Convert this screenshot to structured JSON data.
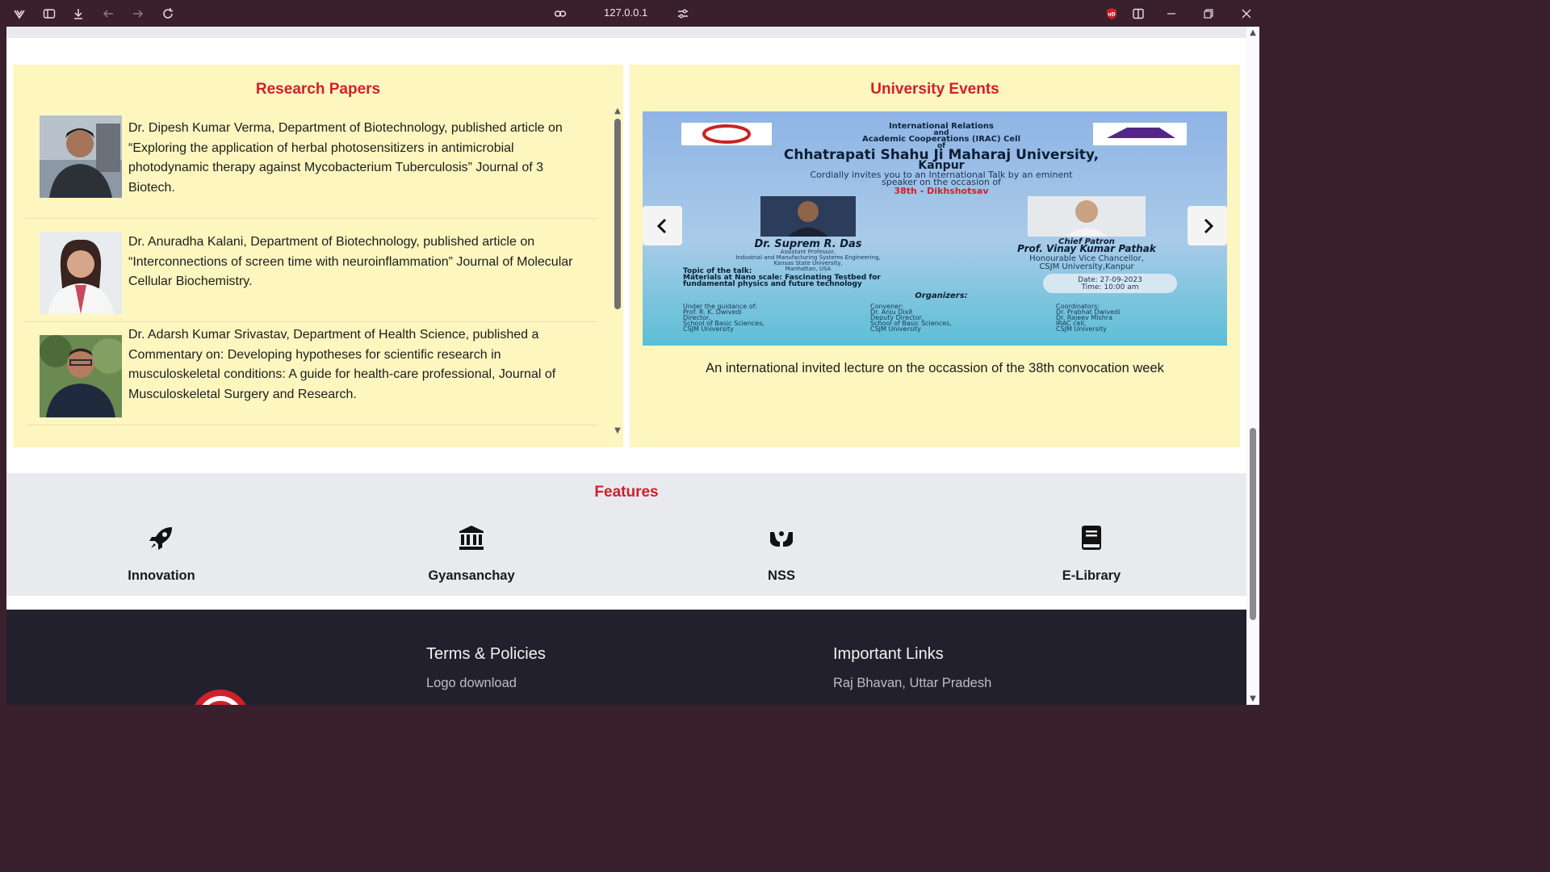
{
  "browser": {
    "url": "127.0.0.1",
    "icons": [
      "vivaldi-logo-icon",
      "panel-toggle-icon",
      "download-icon",
      "back-icon",
      "forward-icon",
      "reload-icon",
      "link-icon",
      "site-settings-icon",
      "ublock-icon",
      "split-view-icon",
      "minimize-icon",
      "restore-icon",
      "close-icon"
    ],
    "ublock_badge": "uD"
  },
  "research": {
    "title": "Research Papers",
    "papers": [
      {
        "text": "Dr. Dipesh Kumar Verma, Department of Biotechnology, published article on “Exploring the application of herbal photosensitizers in antimicrobial photodynamic therapy against Mycobacterium Tuberculosis” Journal of 3 Biotech."
      },
      {
        "text": "Dr. Anuradha Kalani, Department of Biotechnology, published article on “Interconnections of screen time with neuroinflammation” Journal of Molecular Cellular Biochemistry."
      },
      {
        "text": "Dr. Adarsh Kumar Srivastav, Department of Health Science, published a Commentary on: Developing hypotheses for scientific research in musculoskeletal conditions: A guide for health-care professional, Journal of Musculoskeletal Surgery and Research."
      }
    ]
  },
  "events": {
    "title": "University Events",
    "caption": "An international invited lecture on the occassion of the 38th convocation week",
    "poster": {
      "line1": "International Relations",
      "line2": "and",
      "line3": "Academic Cooperations (IRAC) Cell",
      "line4": "of",
      "university": "Chhatrapati Shahu Ji Maharaj University,",
      "city": "Kanpur",
      "invite": "Cordially invites you to an International Talk by an eminent",
      "invite2": "speaker on the occasion of",
      "occasion": "38th - Dikhshotsav",
      "speaker": "Dr. Suprem R. Das",
      "speaker_role": "Assistant Professor,",
      "speaker_dept": "Industrial and Manufacturing Systems Engineering,",
      "speaker_univ": "Kansas State University,",
      "speaker_city": "Manhattan, USA",
      "patron_label": "Chief Patron",
      "patron": "Prof. Vinay Kumar Pathak",
      "patron_role": "Honourable Vice Chancellor,",
      "patron_univ": "CSJM University,Kanpur",
      "topic_label": "Topic of the talk:",
      "topic": "Materials at Nano scale: Fascinating Testbed for",
      "topic2": "fundamental physics and future technology",
      "date": "Date: 27-09-2023",
      "time": "Time: 10:00 am",
      "organizers": "Organizers:",
      "guidance_label": "Under the guidance of:",
      "guidance": "Prof. R. K. Dwivedi",
      "guidance_role": "Director,",
      "guidance_school": "School of Basic Sciences,",
      "guidance_univ": "CSJM University",
      "convener_label": "Convener:",
      "convener": "Dr. Anju Dixit",
      "convener_role": "Deputy Director,",
      "convener_school": "School of Basic Sciences,",
      "convener_univ": "CSJM University",
      "coord_label": "Coordinators:",
      "coord1": "Dr. Prabhat Dwivedi",
      "coord2": "Dr. Rajeev Mishra",
      "coord_cell": "IRAC cell,",
      "coord_univ": "CSJM University"
    }
  },
  "features": {
    "title": "Features",
    "items": [
      {
        "label": "Innovation",
        "icon": "rocket-icon"
      },
      {
        "label": "Gyansanchay",
        "icon": "institution-icon"
      },
      {
        "label": "NSS",
        "icon": "hands-icon"
      },
      {
        "label": "E-Library",
        "icon": "book-icon"
      }
    ]
  },
  "footer": {
    "col1": {
      "heading": "Terms & Policies",
      "links": [
        "Logo download"
      ]
    },
    "col2": {
      "heading": "Important Links",
      "links": [
        "Raj Bhavan, Uttar Pradesh"
      ]
    }
  },
  "colors": {
    "accent_red": "#d0202c",
    "panel_bg": "#fdf6bf",
    "footer_bg": "#22202c",
    "chrome_bg": "#3a1f2c"
  }
}
